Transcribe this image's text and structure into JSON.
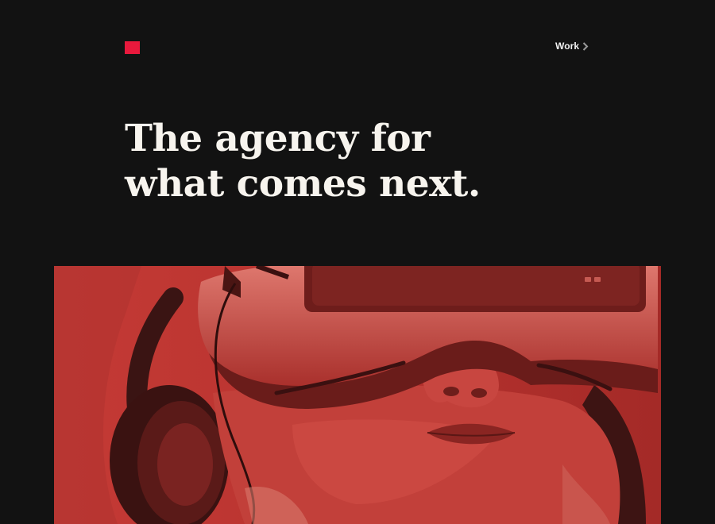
{
  "brand": {
    "logo_icon": "red-square-logo-icon",
    "accent_color": "#e8193c"
  },
  "nav": {
    "work_label": "Work",
    "work_icon": "chevron-right-icon"
  },
  "hero": {
    "title_line_1": "The agency for",
    "title_line_2": "what comes next.",
    "image_tint": "#b3322e"
  }
}
